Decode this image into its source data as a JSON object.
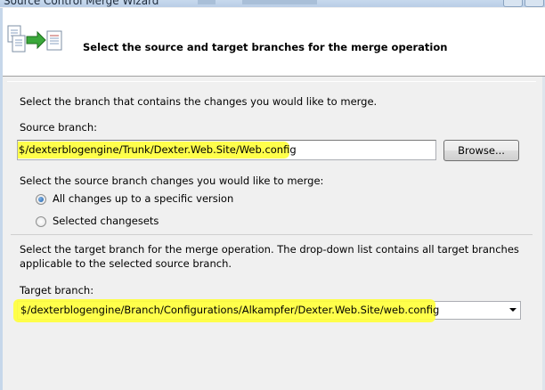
{
  "window": {
    "title": "Source Control Merge Wizard"
  },
  "header": {
    "title": "Select the source and target branches for the merge operation",
    "icon": "merge-wizard-icon"
  },
  "source": {
    "intro": "Select the branch that contains the changes you would like to merge.",
    "branch_label": "Source branch:",
    "branch_value": "$/dexterblogengine/Trunk/Dexter.Web.Site/Web.config",
    "browse_label": "Browse..."
  },
  "changes": {
    "prompt": "Select the source branch changes you would like to merge:",
    "options": [
      {
        "label": "All changes up to a specific version",
        "selected": true
      },
      {
        "label": "Selected changesets",
        "selected": false
      }
    ]
  },
  "target": {
    "intro_line1": "Select the target branch for the merge operation.  The drop-down list contains all target branches",
    "intro_line2": "applicable to the selected source branch.",
    "branch_label": "Target branch:",
    "branch_value": "$/dexterblogengine/Branch/Configurations/Alkampfer/Dexter.Web.Site/web.config"
  },
  "colors": {
    "highlight": "#ffff3c",
    "radio_selected": "#1f5fa8"
  }
}
